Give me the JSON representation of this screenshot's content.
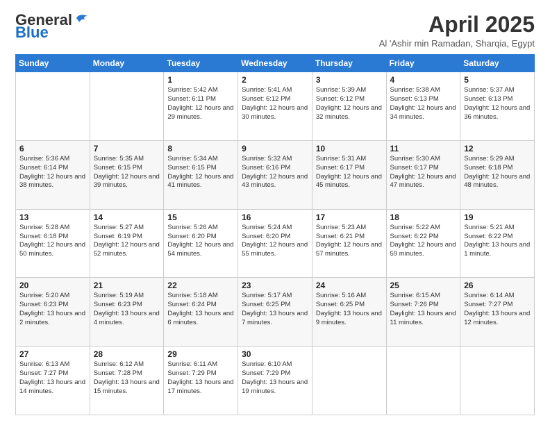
{
  "logo": {
    "general": "General",
    "blue": "Blue"
  },
  "title": {
    "month": "April 2025",
    "location": "Al 'Ashir min Ramadan, Sharqia, Egypt"
  },
  "weekdays": [
    "Sunday",
    "Monday",
    "Tuesday",
    "Wednesday",
    "Thursday",
    "Friday",
    "Saturday"
  ],
  "weeks": [
    [
      {
        "day": "",
        "info": ""
      },
      {
        "day": "",
        "info": ""
      },
      {
        "day": "1",
        "info": "Sunrise: 5:42 AM\nSunset: 6:11 PM\nDaylight: 12 hours and 29 minutes."
      },
      {
        "day": "2",
        "info": "Sunrise: 5:41 AM\nSunset: 6:12 PM\nDaylight: 12 hours and 30 minutes."
      },
      {
        "day": "3",
        "info": "Sunrise: 5:39 AM\nSunset: 6:12 PM\nDaylight: 12 hours and 32 minutes."
      },
      {
        "day": "4",
        "info": "Sunrise: 5:38 AM\nSunset: 6:13 PM\nDaylight: 12 hours and 34 minutes."
      },
      {
        "day": "5",
        "info": "Sunrise: 5:37 AM\nSunset: 6:13 PM\nDaylight: 12 hours and 36 minutes."
      }
    ],
    [
      {
        "day": "6",
        "info": "Sunrise: 5:36 AM\nSunset: 6:14 PM\nDaylight: 12 hours and 38 minutes."
      },
      {
        "day": "7",
        "info": "Sunrise: 5:35 AM\nSunset: 6:15 PM\nDaylight: 12 hours and 39 minutes."
      },
      {
        "day": "8",
        "info": "Sunrise: 5:34 AM\nSunset: 6:15 PM\nDaylight: 12 hours and 41 minutes."
      },
      {
        "day": "9",
        "info": "Sunrise: 5:32 AM\nSunset: 6:16 PM\nDaylight: 12 hours and 43 minutes."
      },
      {
        "day": "10",
        "info": "Sunrise: 5:31 AM\nSunset: 6:17 PM\nDaylight: 12 hours and 45 minutes."
      },
      {
        "day": "11",
        "info": "Sunrise: 5:30 AM\nSunset: 6:17 PM\nDaylight: 12 hours and 47 minutes."
      },
      {
        "day": "12",
        "info": "Sunrise: 5:29 AM\nSunset: 6:18 PM\nDaylight: 12 hours and 48 minutes."
      }
    ],
    [
      {
        "day": "13",
        "info": "Sunrise: 5:28 AM\nSunset: 6:18 PM\nDaylight: 12 hours and 50 minutes."
      },
      {
        "day": "14",
        "info": "Sunrise: 5:27 AM\nSunset: 6:19 PM\nDaylight: 12 hours and 52 minutes."
      },
      {
        "day": "15",
        "info": "Sunrise: 5:26 AM\nSunset: 6:20 PM\nDaylight: 12 hours and 54 minutes."
      },
      {
        "day": "16",
        "info": "Sunrise: 5:24 AM\nSunset: 6:20 PM\nDaylight: 12 hours and 55 minutes."
      },
      {
        "day": "17",
        "info": "Sunrise: 5:23 AM\nSunset: 6:21 PM\nDaylight: 12 hours and 57 minutes."
      },
      {
        "day": "18",
        "info": "Sunrise: 5:22 AM\nSunset: 6:22 PM\nDaylight: 12 hours and 59 minutes."
      },
      {
        "day": "19",
        "info": "Sunrise: 5:21 AM\nSunset: 6:22 PM\nDaylight: 13 hours and 1 minute."
      }
    ],
    [
      {
        "day": "20",
        "info": "Sunrise: 5:20 AM\nSunset: 6:23 PM\nDaylight: 13 hours and 2 minutes."
      },
      {
        "day": "21",
        "info": "Sunrise: 5:19 AM\nSunset: 6:23 PM\nDaylight: 13 hours and 4 minutes."
      },
      {
        "day": "22",
        "info": "Sunrise: 5:18 AM\nSunset: 6:24 PM\nDaylight: 13 hours and 6 minutes."
      },
      {
        "day": "23",
        "info": "Sunrise: 5:17 AM\nSunset: 6:25 PM\nDaylight: 13 hours and 7 minutes."
      },
      {
        "day": "24",
        "info": "Sunrise: 5:16 AM\nSunset: 6:25 PM\nDaylight: 13 hours and 9 minutes."
      },
      {
        "day": "25",
        "info": "Sunrise: 6:15 AM\nSunset: 7:26 PM\nDaylight: 13 hours and 11 minutes."
      },
      {
        "day": "26",
        "info": "Sunrise: 6:14 AM\nSunset: 7:27 PM\nDaylight: 13 hours and 12 minutes."
      }
    ],
    [
      {
        "day": "27",
        "info": "Sunrise: 6:13 AM\nSunset: 7:27 PM\nDaylight: 13 hours and 14 minutes."
      },
      {
        "day": "28",
        "info": "Sunrise: 6:12 AM\nSunset: 7:28 PM\nDaylight: 13 hours and 15 minutes."
      },
      {
        "day": "29",
        "info": "Sunrise: 6:11 AM\nSunset: 7:29 PM\nDaylight: 13 hours and 17 minutes."
      },
      {
        "day": "30",
        "info": "Sunrise: 6:10 AM\nSunset: 7:29 PM\nDaylight: 13 hours and 19 minutes."
      },
      {
        "day": "",
        "info": ""
      },
      {
        "day": "",
        "info": ""
      },
      {
        "day": "",
        "info": ""
      }
    ]
  ]
}
